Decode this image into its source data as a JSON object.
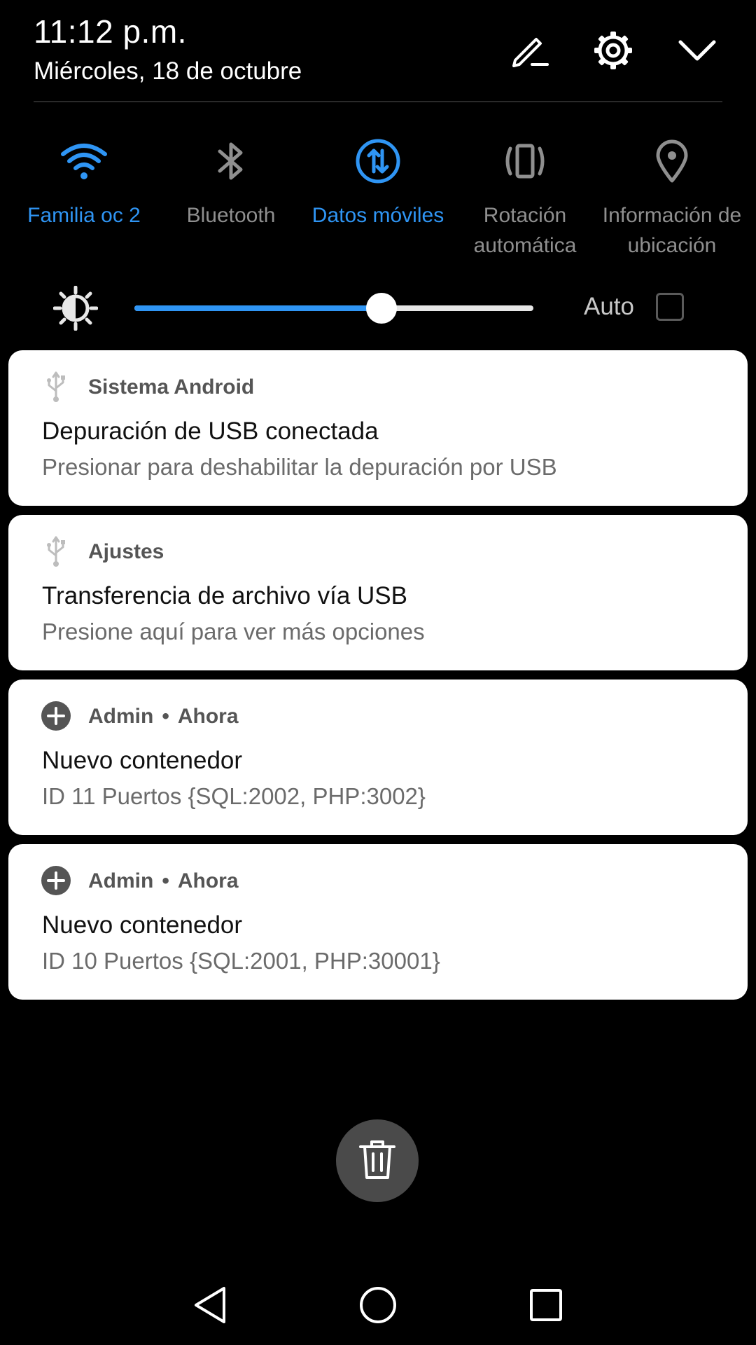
{
  "header": {
    "time": "11:12 p.m.",
    "date": "Miércoles, 18 de octubre",
    "edit_icon": "pencil-icon",
    "settings_icon": "gear-icon",
    "collapse_icon": "chevron-down-icon"
  },
  "toggles": [
    {
      "label": "Familia oc 2",
      "icon": "wifi-icon",
      "active": true
    },
    {
      "label": "Bluetooth",
      "icon": "bluetooth-icon",
      "active": false
    },
    {
      "label": "Datos móviles",
      "icon": "mobile-data-icon",
      "active": true
    },
    {
      "label": "Rotación\nautomática",
      "icon": "auto-rotate-icon",
      "active": false
    },
    {
      "label": "Información de\nubicación",
      "icon": "location-icon",
      "active": false
    }
  ],
  "brightness": {
    "icon": "brightness-icon",
    "level": 0.62,
    "auto_label": "Auto",
    "auto_checked": false
  },
  "notifications": [
    {
      "icon": "usb-icon",
      "app": "Sistema Android",
      "time": "",
      "title": "Depuración de USB conectada",
      "body": "Presionar para deshabilitar la depuración por USB"
    },
    {
      "icon": "usb-icon",
      "app": "Ajustes",
      "time": "",
      "title": "Transferencia de archivo vía USB",
      "body": "Presione aquí para ver más opciones"
    },
    {
      "icon": "plus-circle-icon",
      "app": "Admin",
      "time": "Ahora",
      "title": "Nuevo contenedor",
      "body": "ID 11 Puertos {SQL:2002, PHP:3002}"
    },
    {
      "icon": "plus-circle-icon",
      "app": "Admin",
      "time": "Ahora",
      "title": "Nuevo contenedor",
      "body": "ID 10 Puertos {SQL:2001, PHP:30001}"
    }
  ],
  "clear_all": {
    "icon": "trash-icon"
  },
  "navbar": {
    "back_icon": "back-triangle-icon",
    "home_icon": "home-circle-icon",
    "recents_icon": "recents-square-icon"
  },
  "colors": {
    "accent": "#2f95f4",
    "inactive": "#8f8f8f",
    "background": "#000000",
    "card": "#ffffff"
  }
}
